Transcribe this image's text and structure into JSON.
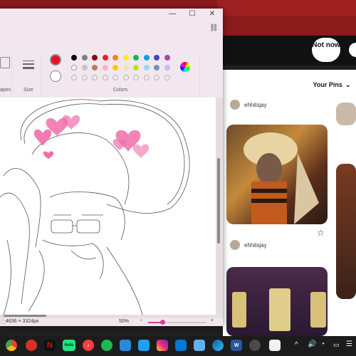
{
  "browser": {
    "pins_header": {
      "not_now": "Not now"
    },
    "your_pins_label": "Your Pins",
    "users": [
      "ehhitsjay",
      "ehhitsjay"
    ]
  },
  "paint": {
    "ribbon": {
      "shapes_label": "apes",
      "size_label": "Size",
      "colors_label": "Colors",
      "palette_row1": [
        "#000000",
        "#7f7f7f",
        "#880015",
        "#ed1c24",
        "#ff7f27",
        "#fff200",
        "#22b14c",
        "#00a2e8",
        "#3f48cc",
        "#a349a4"
      ],
      "palette_row2": [
        "#ffffff",
        "#c3c3c3",
        "#b97a57",
        "#ffaec9",
        "#ffc90e",
        "#efe4b0",
        "#b5e61d",
        "#99d9ea",
        "#7092be",
        "#c8bfe7"
      ],
      "primary_color": "#e81123",
      "secondary_color": "#ffffff"
    },
    "status": {
      "dimensions": "4636 × 3324px",
      "zoom": "50%",
      "zoom_level": 0.5
    }
  },
  "taskbar": {
    "icons": [
      "chrome",
      "pdf",
      "netflix",
      "hulu",
      "itunes",
      "spotify",
      "calendar",
      "twitter",
      "instagram",
      "email",
      "photos",
      "edge",
      "word",
      "settings",
      "file",
      "up",
      "volume",
      "network",
      "battery",
      "notifications"
    ]
  }
}
